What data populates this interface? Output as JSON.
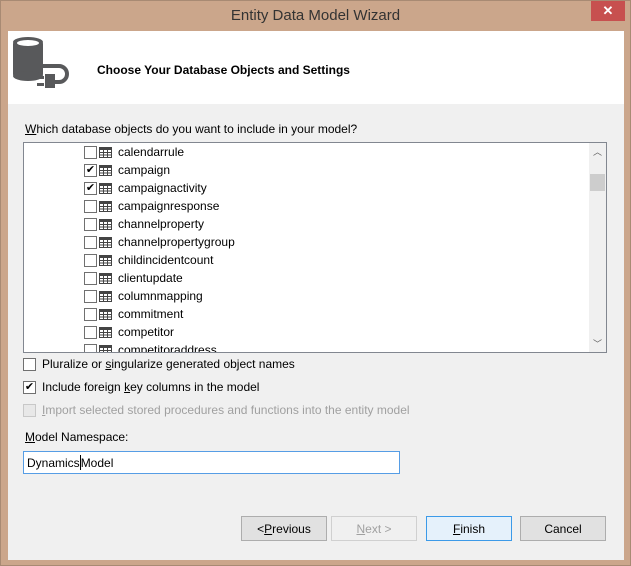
{
  "window": {
    "title": "Entity Data Model Wizard",
    "close_icon": "close-icon"
  },
  "header": {
    "title": "Choose Your Database Objects and Settings",
    "icon": "database-plug-icon"
  },
  "question": {
    "accel": "W",
    "rest": "hich database objects do you want to include in your model?"
  },
  "objects": [
    {
      "label": "calendarrule",
      "checked": false
    },
    {
      "label": "campaign",
      "checked": true
    },
    {
      "label": "campaignactivity",
      "checked": true
    },
    {
      "label": "campaignresponse",
      "checked": false
    },
    {
      "label": "channelproperty",
      "checked": false
    },
    {
      "label": "channelpropertygroup",
      "checked": false
    },
    {
      "label": "childincidentcount",
      "checked": false
    },
    {
      "label": "clientupdate",
      "checked": false
    },
    {
      "label": "columnmapping",
      "checked": false
    },
    {
      "label": "commitment",
      "checked": false
    },
    {
      "label": "competitor",
      "checked": false
    },
    {
      "label": "competitoraddress",
      "checked": false
    }
  ],
  "options": {
    "pluralize": {
      "pre": "Pluralize or ",
      "accel": "s",
      "post": "ingularize generated object names",
      "checked": false,
      "enabled": true
    },
    "foreign_keys": {
      "pre": "Include foreign ",
      "accel": "k",
      "post": "ey columns in the model",
      "checked": true,
      "enabled": true
    },
    "import_procs": {
      "pre": "",
      "accel": "I",
      "post": "mport selected stored procedures and functions into the entity model",
      "checked": false,
      "enabled": false
    }
  },
  "namespace": {
    "label_accel": "M",
    "label_rest": "odel Namespace:",
    "value_before_caret": "Dynamics",
    "value_after_caret": "Model"
  },
  "buttons": {
    "previous": {
      "pre": "< ",
      "accel": "P",
      "post": "revious",
      "enabled": true
    },
    "next": {
      "pre": "",
      "accel": "N",
      "post": "ext >",
      "enabled": false
    },
    "finish": {
      "pre": "",
      "accel": "F",
      "post": "inish",
      "enabled": true
    },
    "cancel": {
      "label": "Cancel",
      "enabled": true
    }
  }
}
